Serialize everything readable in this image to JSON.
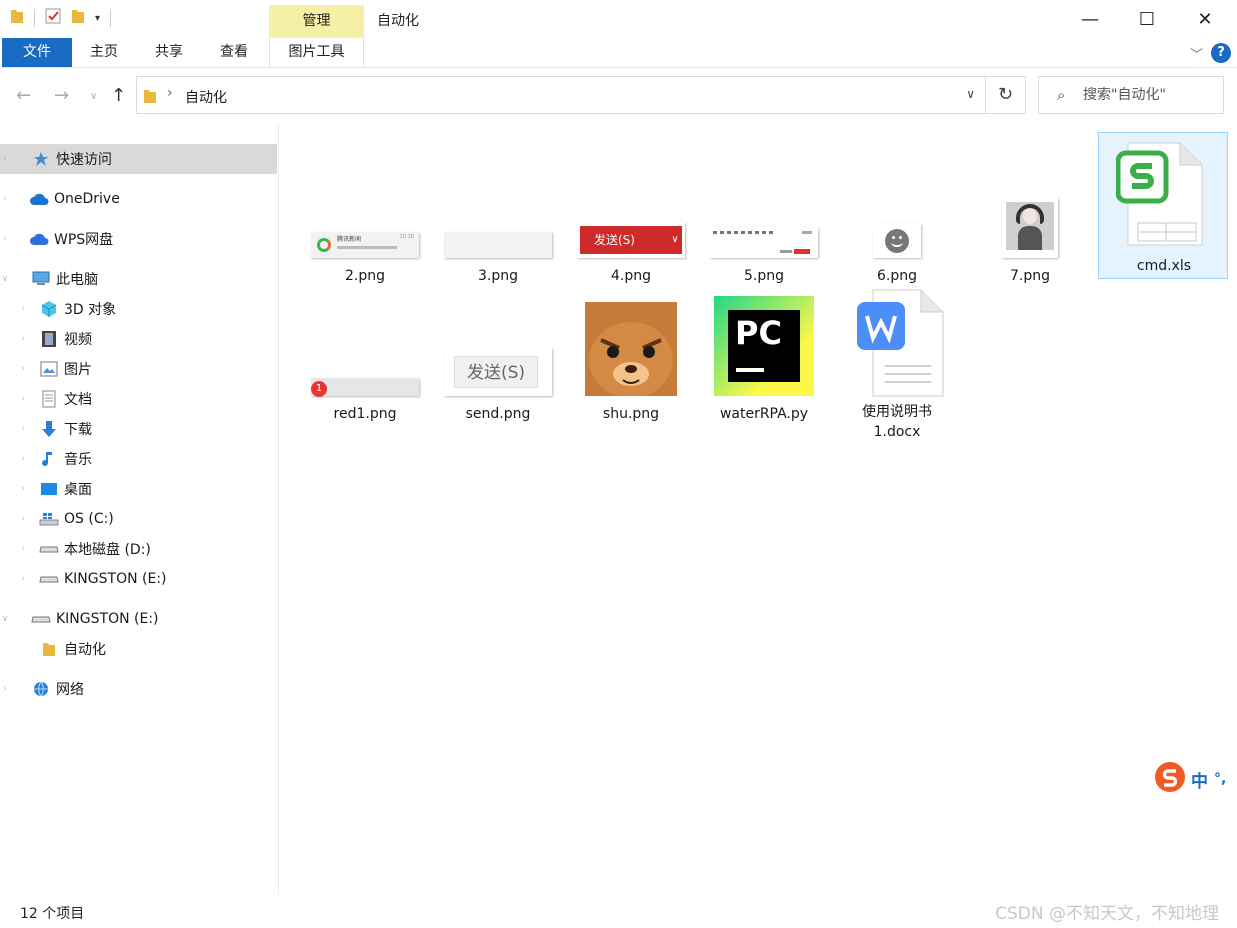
{
  "window": {
    "title": "自动化",
    "context_tab": "管理",
    "controls": [
      "—",
      "☐",
      "✕"
    ]
  },
  "ribbon": {
    "tabs": [
      "文件",
      "主页",
      "共享",
      "查看",
      "图片工具"
    ],
    "help": "?"
  },
  "address": {
    "crumb": "自动化",
    "search_placeholder": "搜索\"自动化\""
  },
  "sidebar": {
    "items": [
      {
        "label": "快速访问",
        "icon": "star-icon"
      },
      {
        "label": "OneDrive",
        "icon": "cloud-icon"
      },
      {
        "label": "WPS网盘",
        "icon": "cloud-icon"
      },
      {
        "label": "此电脑",
        "icon": "computer-icon"
      },
      {
        "label": "3D 对象",
        "icon": "cube-icon"
      },
      {
        "label": "视频",
        "icon": "film-icon"
      },
      {
        "label": "图片",
        "icon": "picture-icon"
      },
      {
        "label": "文档",
        "icon": "document-icon"
      },
      {
        "label": "下载",
        "icon": "download-icon"
      },
      {
        "label": "音乐",
        "icon": "music-icon"
      },
      {
        "label": "桌面",
        "icon": "desktop-icon"
      },
      {
        "label": "OS (C:)",
        "icon": "windows-drive-icon"
      },
      {
        "label": "本地磁盘 (D:)",
        "icon": "drive-icon"
      },
      {
        "label": "KINGSTON (E:)",
        "icon": "drive-icon"
      },
      {
        "label": "KINGSTON (E:)",
        "icon": "usb-drive-icon"
      },
      {
        "label": "自动化",
        "icon": "folder-icon"
      },
      {
        "label": "网络",
        "icon": "network-icon"
      }
    ]
  },
  "files": [
    {
      "name": "2.png",
      "thumb_text": "腾讯新闻",
      "thumb_time": "10:16"
    },
    {
      "name": "3.png"
    },
    {
      "name": "4.png",
      "thumb_text": "发送(S)"
    },
    {
      "name": "5.png"
    },
    {
      "name": "6.png"
    },
    {
      "name": "7.png"
    },
    {
      "name": "cmd.xls"
    },
    {
      "name": "red1.png",
      "badge": "1"
    },
    {
      "name": "send.png",
      "thumb_text": "发送(S)"
    },
    {
      "name": "shu.png"
    },
    {
      "name": "waterRPA.py",
      "thumb_text": "PC"
    },
    {
      "name": "使用说明书\n1.docx"
    }
  ],
  "status": {
    "item_count": "12 个项目",
    "watermark": "CSDN @不知天文，不知地理"
  },
  "ime": {
    "mode": "中",
    "punct": "°,"
  },
  "colors": {
    "accent": "#1a6bc4",
    "manage_tab": "#f6f0a6",
    "selected_nav": "#d9d9d9"
  }
}
